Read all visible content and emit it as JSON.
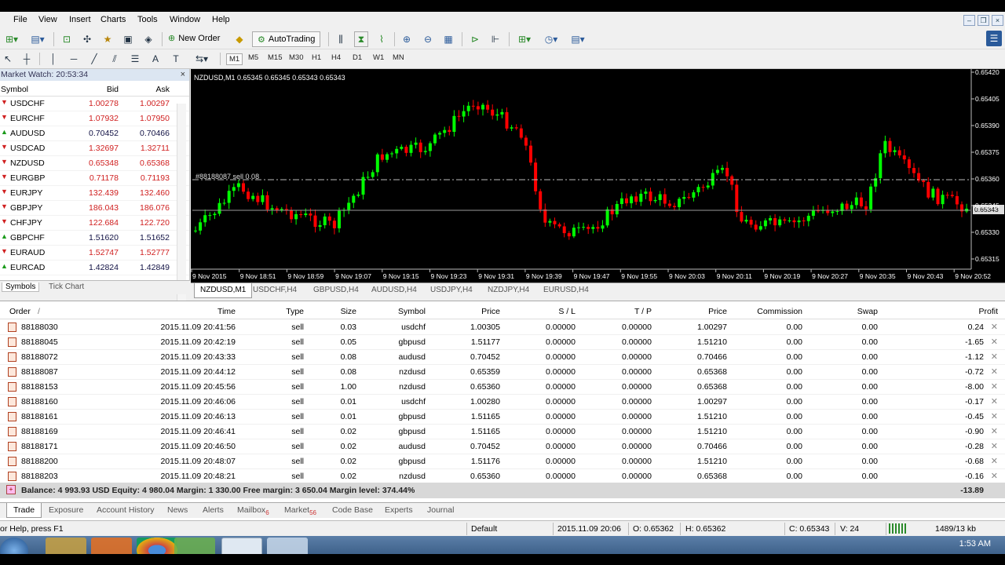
{
  "menu": [
    "File",
    "View",
    "Insert",
    "Charts",
    "Tools",
    "Window",
    "Help"
  ],
  "toolbar": {
    "new_order": "New Order",
    "autotrading": "AutoTrading",
    "timeframes": [
      "M1",
      "M5",
      "M15",
      "M30",
      "H1",
      "H4",
      "D1",
      "W1",
      "MN"
    ]
  },
  "market_watch": {
    "title": "Market Watch: 20:53:34",
    "headers": {
      "symbol": "Symbol",
      "bid": "Bid",
      "ask": "Ask"
    },
    "rows": [
      {
        "symbol": "USDCHF",
        "bid": "1.00278",
        "ask": "1.00297",
        "dir": "down"
      },
      {
        "symbol": "EURCHF",
        "bid": "1.07932",
        "ask": "1.07950",
        "dir": "down"
      },
      {
        "symbol": "AUDUSD",
        "bid": "0.70452",
        "ask": "0.70466",
        "dir": "up"
      },
      {
        "symbol": "USDCAD",
        "bid": "1.32697",
        "ask": "1.32711",
        "dir": "down"
      },
      {
        "symbol": "NZDUSD",
        "bid": "0.65348",
        "ask": "0.65368",
        "dir": "down"
      },
      {
        "symbol": "EURGBP",
        "bid": "0.71178",
        "ask": "0.71193",
        "dir": "down"
      },
      {
        "symbol": "EURJPY",
        "bid": "132.439",
        "ask": "132.460",
        "dir": "down"
      },
      {
        "symbol": "GBPJPY",
        "bid": "186.043",
        "ask": "186.076",
        "dir": "down"
      },
      {
        "symbol": "CHFJPY",
        "bid": "122.684",
        "ask": "122.720",
        "dir": "down"
      },
      {
        "symbol": "GBPCHF",
        "bid": "1.51620",
        "ask": "1.51652",
        "dir": "up"
      },
      {
        "symbol": "EURAUD",
        "bid": "1.52747",
        "ask": "1.52777",
        "dir": "down"
      },
      {
        "symbol": "EURCAD",
        "bid": "1.42824",
        "ask": "1.42849",
        "dir": "up"
      }
    ],
    "tabs": [
      "Symbols",
      "Tick Chart"
    ]
  },
  "chart": {
    "header": "NZDUSD,M1  0.65345 0.65345 0.65343 0.65343",
    "order_label": "#88188087 sell 0.08",
    "price_labels": [
      "0.65420",
      "0.65405",
      "0.65390",
      "0.65375",
      "0.65360",
      "0.65345",
      "0.65330",
      "0.65315"
    ],
    "current_price": "0.65343",
    "time_labels": [
      "9 Nov 2015",
      "9 Nov 18:51",
      "9 Nov 18:59",
      "9 Nov 19:07",
      "9 Nov 19:15",
      "9 Nov 19:23",
      "9 Nov 19:31",
      "9 Nov 19:39",
      "9 Nov 19:47",
      "9 Nov 19:55",
      "9 Nov 20:03",
      "9 Nov 20:11",
      "9 Nov 20:19",
      "9 Nov 20:27",
      "9 Nov 20:35",
      "9 Nov 20:43",
      "9 Nov 20:52"
    ],
    "bull_color": "#00ff00",
    "bear_color": "#ff0000"
  },
  "chart_tabs": [
    "NZDUSD,M1",
    "USDCHF,H4",
    "GBPUSD,H4",
    "AUDUSD,H4",
    "USDJPY,H4",
    "NZDJPY,H4",
    "EURUSD,H4"
  ],
  "terminal": {
    "headers": {
      "order": "Order",
      "time": "Time",
      "type": "Type",
      "size": "Size",
      "symbol": "Symbol",
      "price": "Price",
      "sl": "S / L",
      "tp": "T / P",
      "price2": "Price",
      "commission": "Commission",
      "swap": "Swap",
      "profit": "Profit"
    },
    "rows": [
      {
        "order": "88188030",
        "time": "2015.11.09 20:41:56",
        "type": "sell",
        "size": "0.03",
        "symbol": "usdchf",
        "price": "1.00305",
        "sl": "0.00000",
        "tp": "0.00000",
        "price2": "1.00297",
        "commission": "0.00",
        "swap": "0.00",
        "profit": "0.24"
      },
      {
        "order": "88188045",
        "time": "2015.11.09 20:42:19",
        "type": "sell",
        "size": "0.05",
        "symbol": "gbpusd",
        "price": "1.51177",
        "sl": "0.00000",
        "tp": "0.00000",
        "price2": "1.51210",
        "commission": "0.00",
        "swap": "0.00",
        "profit": "-1.65"
      },
      {
        "order": "88188072",
        "time": "2015.11.09 20:43:33",
        "type": "sell",
        "size": "0.08",
        "symbol": "audusd",
        "price": "0.70452",
        "sl": "0.00000",
        "tp": "0.00000",
        "price2": "0.70466",
        "commission": "0.00",
        "swap": "0.00",
        "profit": "-1.12"
      },
      {
        "order": "88188087",
        "time": "2015.11.09 20:44:12",
        "type": "sell",
        "size": "0.08",
        "symbol": "nzdusd",
        "price": "0.65359",
        "sl": "0.00000",
        "tp": "0.00000",
        "price2": "0.65368",
        "commission": "0.00",
        "swap": "0.00",
        "profit": "-0.72"
      },
      {
        "order": "88188153",
        "time": "2015.11.09 20:45:56",
        "type": "sell",
        "size": "1.00",
        "symbol": "nzdusd",
        "price": "0.65360",
        "sl": "0.00000",
        "tp": "0.00000",
        "price2": "0.65368",
        "commission": "0.00",
        "swap": "0.00",
        "profit": "-8.00"
      },
      {
        "order": "88188160",
        "time": "2015.11.09 20:46:06",
        "type": "sell",
        "size": "0.01",
        "symbol": "usdchf",
        "price": "1.00280",
        "sl": "0.00000",
        "tp": "0.00000",
        "price2": "1.00297",
        "commission": "0.00",
        "swap": "0.00",
        "profit": "-0.17"
      },
      {
        "order": "88188161",
        "time": "2015.11.09 20:46:13",
        "type": "sell",
        "size": "0.01",
        "symbol": "gbpusd",
        "price": "1.51165",
        "sl": "0.00000",
        "tp": "0.00000",
        "price2": "1.51210",
        "commission": "0.00",
        "swap": "0.00",
        "profit": "-0.45"
      },
      {
        "order": "88188169",
        "time": "2015.11.09 20:46:41",
        "type": "sell",
        "size": "0.02",
        "symbol": "gbpusd",
        "price": "1.51165",
        "sl": "0.00000",
        "tp": "0.00000",
        "price2": "1.51210",
        "commission": "0.00",
        "swap": "0.00",
        "profit": "-0.90"
      },
      {
        "order": "88188171",
        "time": "2015.11.09 20:46:50",
        "type": "sell",
        "size": "0.02",
        "symbol": "audusd",
        "price": "0.70452",
        "sl": "0.00000",
        "tp": "0.00000",
        "price2": "0.70466",
        "commission": "0.00",
        "swap": "0.00",
        "profit": "-0.28"
      },
      {
        "order": "88188200",
        "time": "2015.11.09 20:48:07",
        "type": "sell",
        "size": "0.02",
        "symbol": "gbpusd",
        "price": "1.51176",
        "sl": "0.00000",
        "tp": "0.00000",
        "price2": "1.51210",
        "commission": "0.00",
        "swap": "0.00",
        "profit": "-0.68"
      },
      {
        "order": "88188203",
        "time": "2015.11.09 20:48:21",
        "type": "sell",
        "size": "0.02",
        "symbol": "nzdusd",
        "price": "0.65360",
        "sl": "0.00000",
        "tp": "0.00000",
        "price2": "0.65368",
        "commission": "0.00",
        "swap": "0.00",
        "profit": "-0.16"
      }
    ],
    "balance_line": "Balance: 4 993.93 USD  Equity: 4 980.04  Margin: 1 330.00  Free margin: 3 650.04  Margin level: 374.44%",
    "total_profit": "-13.89",
    "tabs": [
      {
        "label": "Trade",
        "count": ""
      },
      {
        "label": "Exposure",
        "count": ""
      },
      {
        "label": "Account History",
        "count": ""
      },
      {
        "label": "News",
        "count": ""
      },
      {
        "label": "Alerts",
        "count": ""
      },
      {
        "label": "Mailbox",
        "count": "6"
      },
      {
        "label": "Market",
        "count": "56"
      },
      {
        "label": "Code Base",
        "count": ""
      },
      {
        "label": "Experts",
        "count": ""
      },
      {
        "label": "Journal",
        "count": ""
      }
    ]
  },
  "status": {
    "help": "or Help, press F1",
    "profile": "Default",
    "datetime": "2015.11.09 20:06",
    "open": "O: 0.65362",
    "high": "H: 0.65362",
    "close": "C: 0.65343",
    "volume": "V: 24",
    "traffic": "1489/13 kb"
  },
  "taskbar": {
    "clock": "1:53 AM"
  }
}
